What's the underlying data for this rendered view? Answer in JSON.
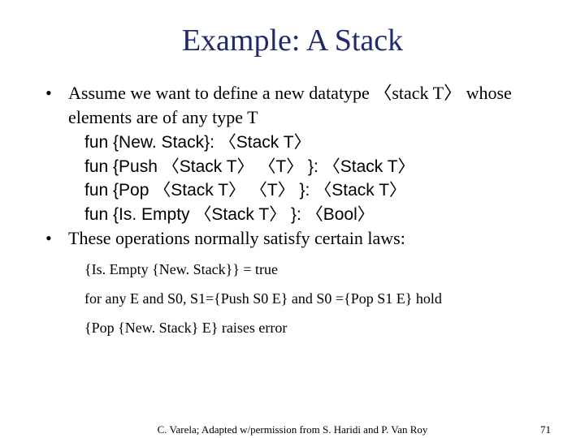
{
  "title": "Example: A Stack",
  "bullets": {
    "b1": "Assume we want to define a new datatype 〈stack T〉 whose elements are of any type T",
    "b2": "These operations normally satisfy certain laws:"
  },
  "sigs": {
    "s1": "fun {New. Stack}: 〈Stack T〉",
    "s2": "fun {Push 〈Stack T〉 〈T〉 }: 〈Stack T〉",
    "s3": "fun {Pop 〈Stack T〉 〈T〉 }: 〈Stack T〉",
    "s4": "fun {Is. Empty 〈Stack T〉 }: 〈Bool〉"
  },
  "laws": {
    "l1": "{Is. Empty {New. Stack}} = true",
    "l2": "for any E and S0, S1={Push S0 E} and S0 ={Pop S1 E} hold",
    "l3": "{Pop {New. Stack} E} raises error"
  },
  "footer": {
    "credit": "C. Varela; Adapted w/permission from S. Haridi and P. Van Roy",
    "page": "71"
  }
}
